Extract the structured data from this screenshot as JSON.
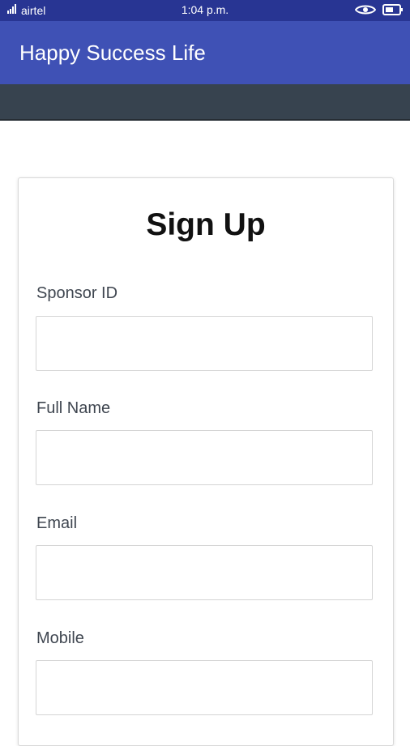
{
  "status_bar": {
    "carrier": "airtel",
    "time": "1:04 p.m.",
    "icons": [
      "signal-icon",
      "eye-icon",
      "battery-icon"
    ]
  },
  "app_bar": {
    "title": "Happy Success Life"
  },
  "signup": {
    "title": "Sign Up",
    "fields": [
      {
        "label": "Sponsor ID",
        "value": "",
        "placeholder": ""
      },
      {
        "label": "Full Name",
        "value": "",
        "placeholder": ""
      },
      {
        "label": "Email",
        "value": "",
        "placeholder": ""
      },
      {
        "label": "Mobile",
        "value": "",
        "placeholder": ""
      }
    ]
  },
  "colors": {
    "status_bar": "#283593",
    "app_bar": "#3f51b5",
    "web_header": "#37434f",
    "card_title": "#111111",
    "label": "#3f4650"
  }
}
